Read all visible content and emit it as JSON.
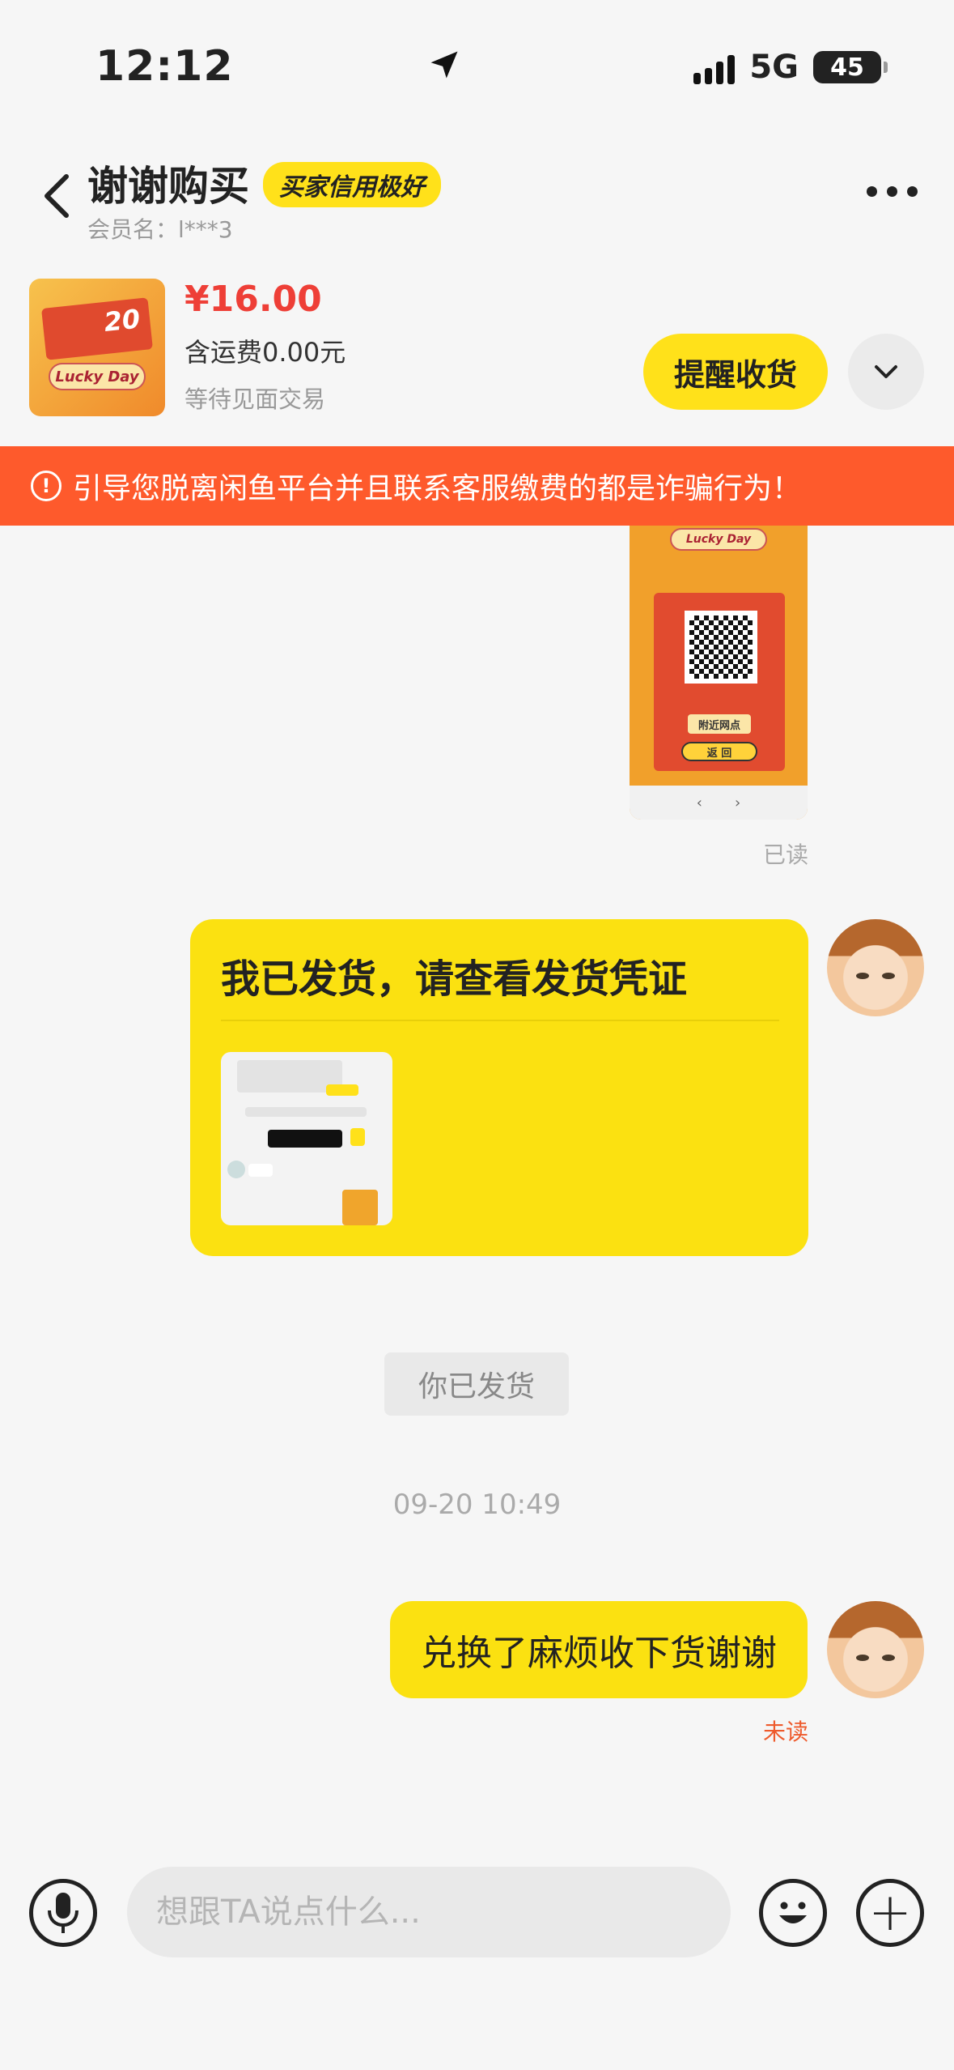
{
  "status_bar": {
    "time": "12:12",
    "network": "5G",
    "battery": "45"
  },
  "header": {
    "title": "谢谢购买",
    "credit_badge": "买家信用极好",
    "member_name": "会员名：l***3"
  },
  "product": {
    "price": "¥16.00",
    "shipping": "含运费0.00元",
    "status": "等待见面交易",
    "remind_button": "提醒收货",
    "image_number": "20",
    "image_text": "Lucky Day"
  },
  "warning": {
    "text": "引导您脱离闲鱼平台并且联系客服缴费的都是诈骗行为！"
  },
  "messages": {
    "qr_image": {
      "top_text": "Lucky Day",
      "button1": "附近网点",
      "button2": "返 回",
      "nav_prev": "‹",
      "nav_next": "›"
    },
    "read_status": "已读",
    "shipped_card_title": "我已发货，请查看发货凭证",
    "system_notice": "你已发货",
    "timestamp": "09-20 10:49",
    "last_message": "兑换了麻烦收下货谢谢",
    "unread_status": "未读"
  },
  "input_bar": {
    "placeholder": "想跟TA说点什么..."
  },
  "colors": {
    "accent_yellow": "#fbe111",
    "warning_orange": "#fe5a2c",
    "price_red": "#ee3f37"
  }
}
